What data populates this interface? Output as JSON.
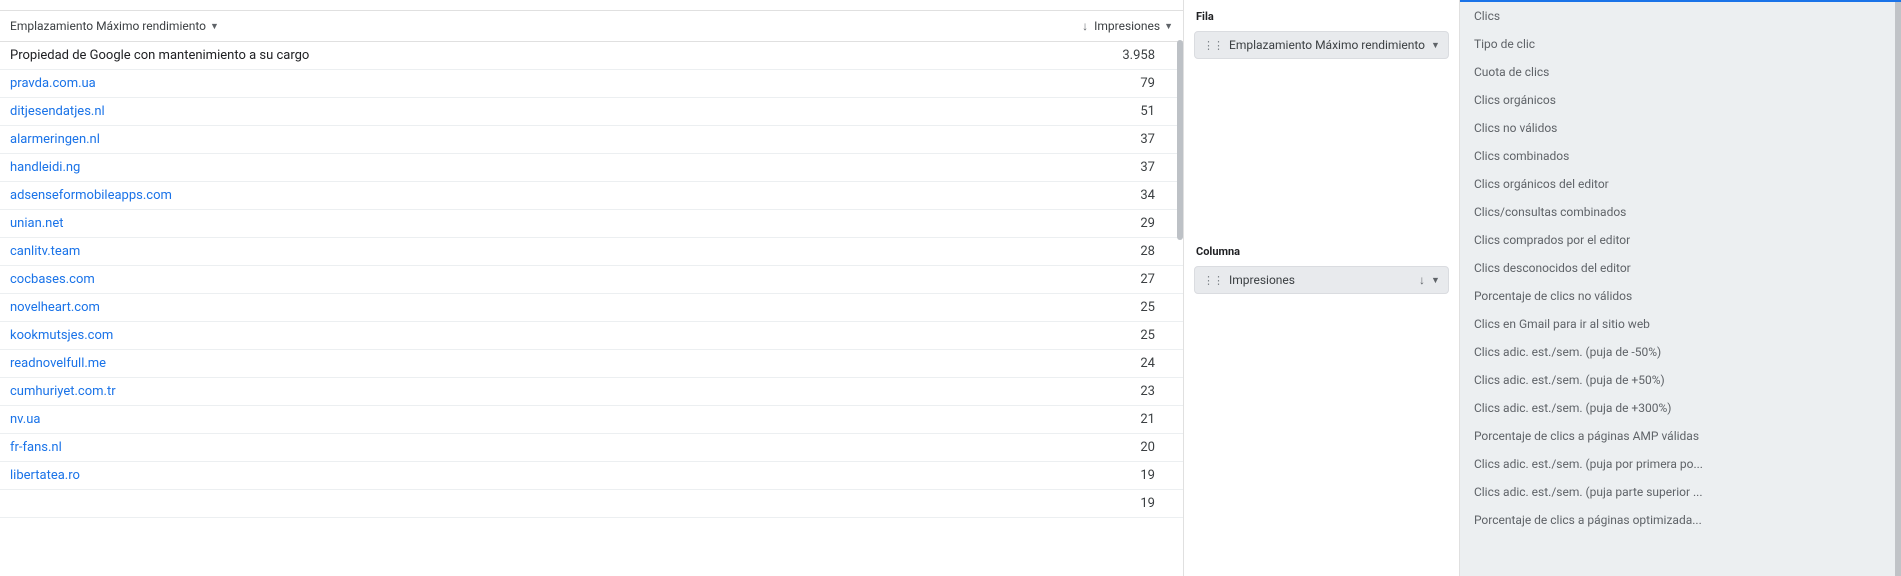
{
  "table": {
    "headers": {
      "placement": "Emplazamiento Máximo rendimiento",
      "impressions": "Impresiones"
    },
    "rows": [
      {
        "label": "Propiedad de Google con mantenimiento a su cargo",
        "value": "3.958",
        "link": false
      },
      {
        "label": "pravda.com.ua",
        "value": "79",
        "link": true
      },
      {
        "label": "ditjesendatjes.nl",
        "value": "51",
        "link": true
      },
      {
        "label": "alarmeringen.nl",
        "value": "37",
        "link": true
      },
      {
        "label": "handleidi.ng",
        "value": "37",
        "link": true
      },
      {
        "label": "adsenseformobileapps.com",
        "value": "34",
        "link": true
      },
      {
        "label": "unian.net",
        "value": "29",
        "link": true
      },
      {
        "label": "canlitv.team",
        "value": "28",
        "link": true
      },
      {
        "label": "cocbases.com",
        "value": "27",
        "link": true
      },
      {
        "label": "novelheart.com",
        "value": "25",
        "link": true
      },
      {
        "label": "kookmutsjes.com",
        "value": "25",
        "link": true
      },
      {
        "label": "readnovelfull.me",
        "value": "24",
        "link": true
      },
      {
        "label": "cumhuriyet.com.tr",
        "value": "23",
        "link": true
      },
      {
        "label": "nv.ua",
        "value": "21",
        "link": true
      },
      {
        "label": "fr-fans.nl",
        "value": "20",
        "link": true
      },
      {
        "label": "libertatea.ro",
        "value": "19",
        "link": true
      },
      {
        "label": "",
        "value": "19",
        "link": true
      }
    ]
  },
  "side": {
    "row_title": "Fila",
    "row_chip": "Emplazamiento Máximo rendimiento",
    "column_title": "Columna",
    "column_chip": "Impresiones"
  },
  "metrics": [
    "Clics",
    "Tipo de clic",
    "Cuota de clics",
    "Clics orgánicos",
    "Clics no válidos",
    "Clics combinados",
    "Clics orgánicos del editor",
    "Clics/consultas combinados",
    "Clics comprados por el editor",
    "Clics desconocidos del editor",
    "Porcentaje de clics no válidos",
    "Clics en Gmail para ir al sitio web",
    "Clics adic. est./sem. (puja de -50%)",
    "Clics adic. est./sem. (puja de +50%)",
    "Clics adic. est./sem. (puja de +300%)",
    "Porcentaje de clics a páginas AMP válidas",
    "Clics adic. est./sem. (puja por primera po...",
    "Clics adic. est./sem. (puja parte superior ...",
    "Porcentaje de clics a páginas optimizada..."
  ]
}
